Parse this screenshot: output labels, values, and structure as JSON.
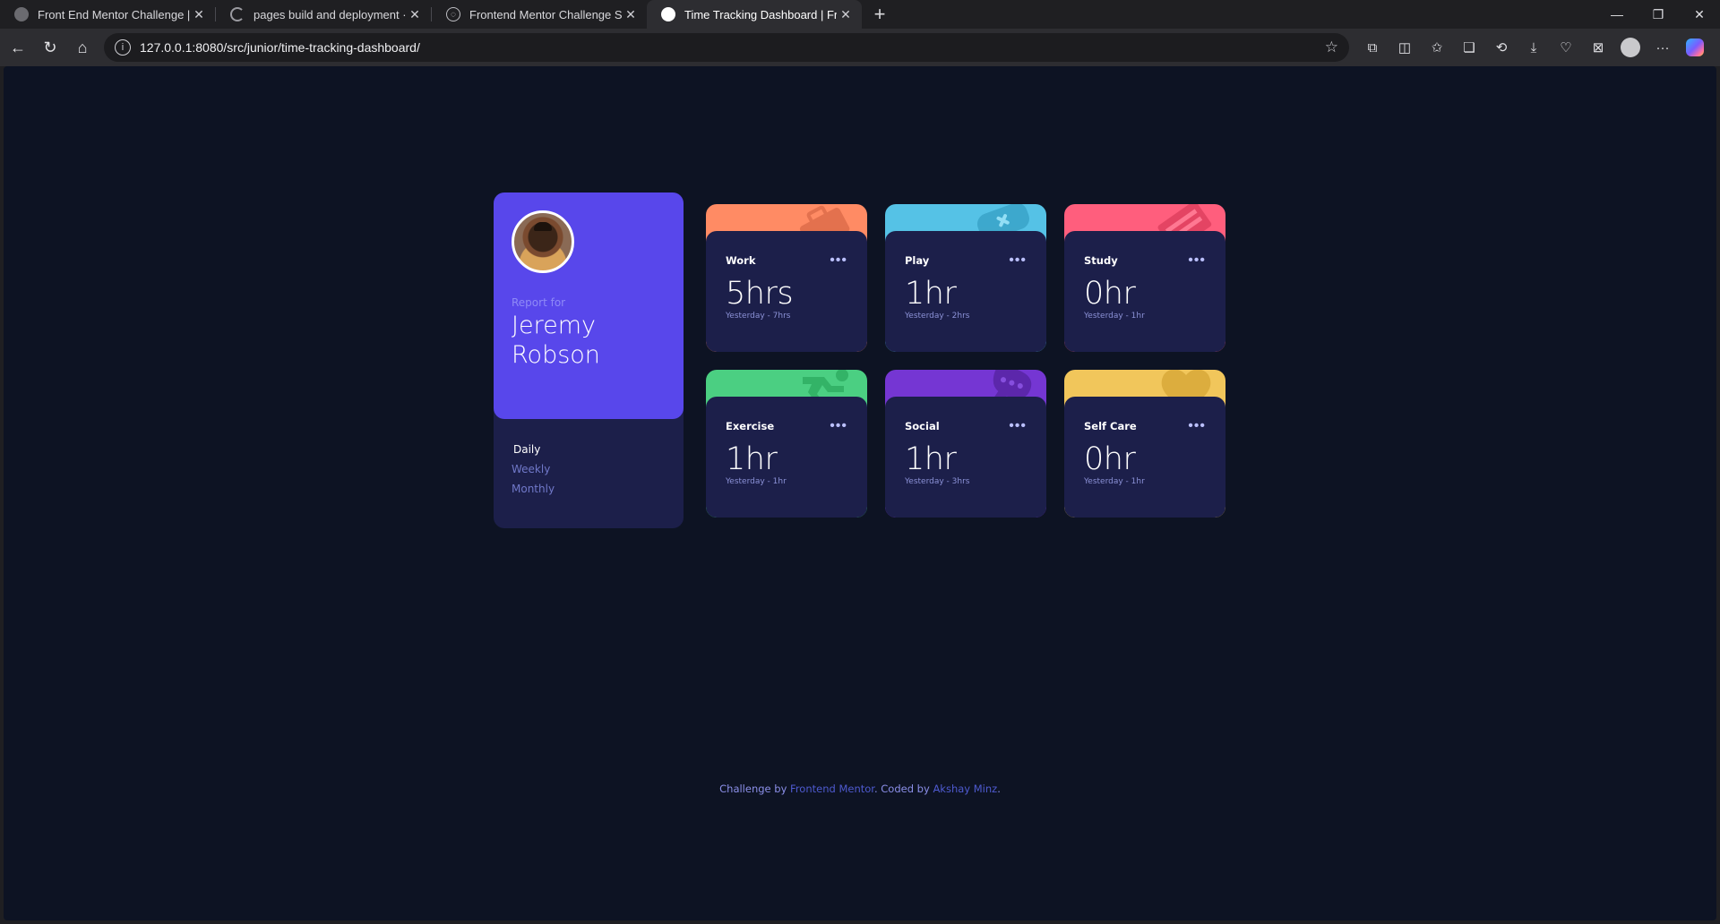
{
  "browser": {
    "tabs": [
      {
        "title": "Front End Mentor Challenge | IP A",
        "active": false
      },
      {
        "title": "pages build and deployment · Ak",
        "active": false
      },
      {
        "title": "Frontend Mentor Challenge Solut",
        "active": false
      },
      {
        "title": "Time Tracking Dashboard | Fronte",
        "active": true
      }
    ],
    "url": "127.0.0.1:8080/src/junior/time-tracking-dashboard/"
  },
  "profile": {
    "report_for": "Report for",
    "name_line1": "Jeremy",
    "name_line2": "Robson",
    "periods": [
      "Daily",
      "Weekly",
      "Monthly"
    ],
    "active_period": "Daily"
  },
  "activities": [
    {
      "label": "Work",
      "hours": "5hrs",
      "previous": "Yesterday - 7hrs",
      "color": "#ff8b64",
      "icon": "briefcase-icon"
    },
    {
      "label": "Play",
      "hours": "1hr",
      "previous": "Yesterday - 2hrs",
      "color": "#55c2e6",
      "icon": "gamepad-icon"
    },
    {
      "label": "Study",
      "hours": "0hr",
      "previous": "Yesterday - 1hr",
      "color": "#ff5e7d",
      "icon": "book-icon"
    },
    {
      "label": "Exercise",
      "hours": "1hr",
      "previous": "Yesterday - 1hr",
      "color": "#4bcf82",
      "icon": "runner-icon"
    },
    {
      "label": "Social",
      "hours": "1hr",
      "previous": "Yesterday - 3hrs",
      "color": "#7536d3",
      "icon": "chat-icon"
    },
    {
      "label": "Self Care",
      "hours": "0hr",
      "previous": "Yesterday - 1hr",
      "color": "#f1c65b",
      "icon": "heart-icon"
    }
  ],
  "attribution": {
    "prefix": "Challenge by ",
    "link1": "Frontend Mentor",
    "middle": ". Coded by ",
    "link2": "Akshay Minz",
    "suffix": "."
  }
}
